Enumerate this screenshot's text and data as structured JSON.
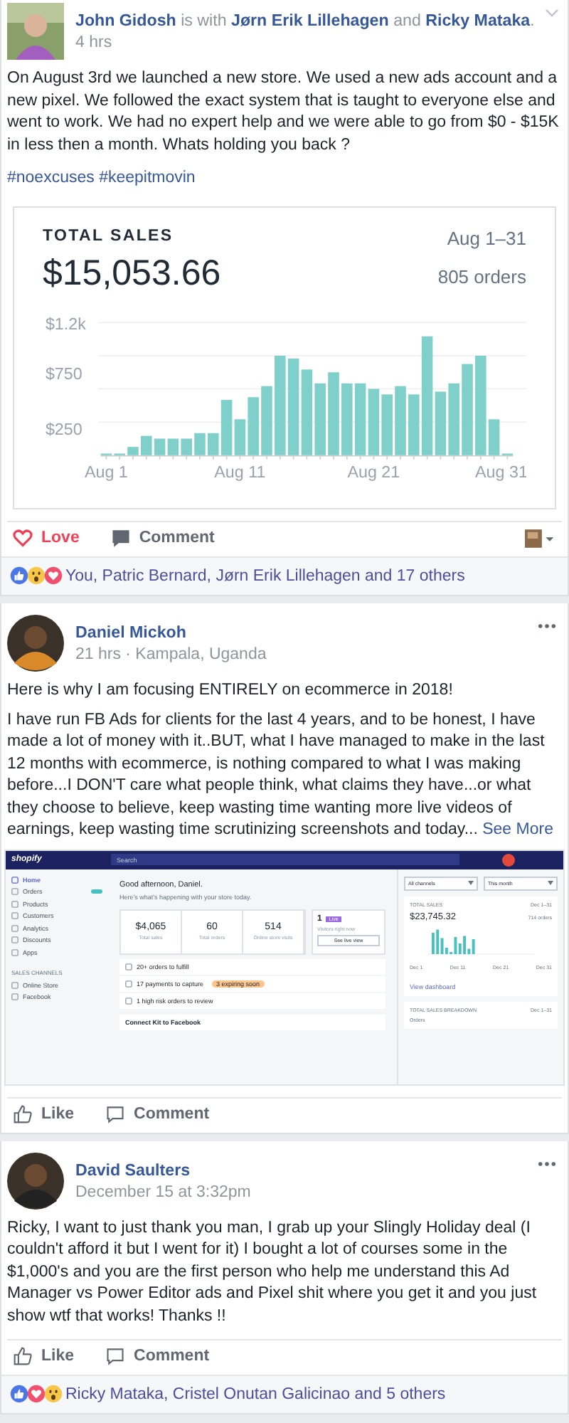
{
  "posts": [
    {
      "kind": "tagged",
      "author": "**John Gidosh** is with **Jørn Erik Lillehagen** and **Ricky Mataka**.",
      "time": "4 hrs",
      "paragraphs": [
        {
          "text": "On August 3rd we launched a new store. We used a new ads account and a new pixel. We followed the exact system that is taught to everyone else and went to work. We had no expert help and we were able to go from $0 - $15K in less then a month. Whats holding you back ?"
        }
      ],
      "hashtags": "#noexcuses #keepitmovin",
      "attachment": {
        "kind": "sales_card",
        "title": "TOTAL SALES",
        "amount": "$15,053.66",
        "range": "Aug 1–31",
        "orders": "805 orders",
        "chart_data": {
          "type": "bar",
          "categories": [
            "Aug 1",
            null,
            null,
            null,
            null,
            null,
            null,
            null,
            null,
            null,
            "Aug 11",
            null,
            null,
            null,
            null,
            null,
            null,
            null,
            null,
            null,
            "Aug 21",
            null,
            null,
            null,
            null,
            null,
            null,
            null,
            null,
            null,
            "Aug 31"
          ],
          "series": [
            {
              "color": "#7fcfca",
              "values": [
                10,
                10,
                75,
                175,
                150,
                150,
                150,
                200,
                200,
                500,
                325,
                525,
                625,
                900,
                875,
                775,
                650,
                750,
                650,
                650,
                600,
                550,
                625,
                550,
                1075,
                575,
                650,
                825,
                900,
                325,
                0
              ]
            }
          ],
          "grid": true,
          "ylim": [
            0,
            1200
          ],
          "yticks": [
            {
              "value": 250,
              "label": "$250"
            },
            {
              "value": 750,
              "label": "$750"
            },
            {
              "value": 1200,
              "label": "$1.2k"
            }
          ]
        }
      },
      "actions": [
        {
          "kind": "love",
          "label": "Love",
          "active": true
        },
        {
          "kind": "comment",
          "label": "Comment",
          "active": false
        }
      ],
      "post_as": true,
      "reactions": {
        "icons": [
          {
            "kind": "like"
          },
          {
            "kind": "wow"
          },
          {
            "kind": "love"
          }
        ],
        "text": "You, Patric Bernard, Jørn Erik Lillehagen and 17 others"
      }
    },
    {
      "kind": "status",
      "author": "**Daniel Mickoh**",
      "time": "21 hrs · Kampala, Uganda",
      "paragraphs": [
        {
          "text": "Here is why I am focusing ENTIRELY on ecommerce in 2018!"
        },
        {
          "text": "I have run FB Ads for clients for the last 4 years, and to be honest, I have made a lot of money with it..BUT, what I have managed to make in the last 12 months with ecommerce, is nothing compared to what I was making before...I DON'T care what people think, what claims they have...or what they choose to believe, keep wasting time wanting more live videos of earnings, keep wasting time scrutinizing screenshots and today... ",
          "link": "See More"
        }
      ],
      "attachment": {
        "kind": "dashboard",
        "brand": "shopify",
        "search": "Search",
        "nav": [
          {
            "label": "Home",
            "selected": true
          },
          {
            "label": "Orders",
            "selected": false,
            "badge": true
          },
          {
            "label": "Products",
            "selected": false
          },
          {
            "label": "Customers",
            "selected": false
          },
          {
            "label": "Analytics",
            "selected": false
          },
          {
            "label": "Discounts",
            "selected": false
          },
          {
            "label": "Apps",
            "selected": false
          }
        ],
        "channels_heading": "SALES CHANNELS",
        "channels": [
          "Online Store",
          "Facebook"
        ],
        "greeting": "Good afternoon, Daniel.",
        "subtitle": "Here's what's happening with your store today.",
        "stats": [
          {
            "value": "$4,065",
            "label": "Total sales"
          },
          {
            "value": "60",
            "label": "Total orders"
          },
          {
            "value": "514",
            "label": "Online store visits"
          }
        ],
        "live": {
          "count": "1",
          "badge": "Live",
          "label": "Visitors right now",
          "button": "See live view"
        },
        "tasks": [
          {
            "text": "20+ orders to fulfill"
          },
          {
            "text": "17 payments to capture",
            "tag": "3 expiring soon"
          },
          {
            "text": "1 high risk orders to review"
          }
        ],
        "connect": "Connect Kit to Facebook",
        "filters": [
          "All channels",
          "This month"
        ],
        "sales": {
          "title": "TOTAL SALES",
          "range": "Dec 1–31",
          "amount": "$23,745.32",
          "orders": "714 orders",
          "xlabels": [
            "Dec 1",
            "Dec 11",
            "Dec 21",
            "Dec 31"
          ]
        },
        "link": "View dashboard",
        "breakdown": {
          "title": "TOTAL SALES BREAKDOWN",
          "range": "Dec 1–31",
          "row": "Orders"
        }
      },
      "actions": [
        {
          "kind": "like",
          "label": "Like",
          "active": false
        },
        {
          "kind": "comment",
          "label": "Comment",
          "active": false
        }
      ]
    },
    {
      "kind": "status",
      "author": "**David Saulters**",
      "time": "December 15 at 3:32pm",
      "paragraphs": [
        {
          "text": "Ricky, I want to just thank you man, I grab up your Slingly Holiday deal (I couldn't afford it but I went for it) I bought a lot of courses some in the $1,000's and you are the first person who help me understand this Ad Manager vs Power Editor ads and Pixel shit where you get it and you just show wtf that works! Thanks !!"
        }
      ],
      "actions": [
        {
          "kind": "like",
          "label": "Like",
          "active": false
        },
        {
          "kind": "comment",
          "label": "Comment",
          "active": false
        }
      ],
      "reactions": {
        "icons": [
          {
            "kind": "like"
          },
          {
            "kind": "love"
          },
          {
            "kind": "wow"
          }
        ],
        "text": "Ricky Mataka, Cristel Onutan Galicinao and 5 others"
      }
    }
  ]
}
